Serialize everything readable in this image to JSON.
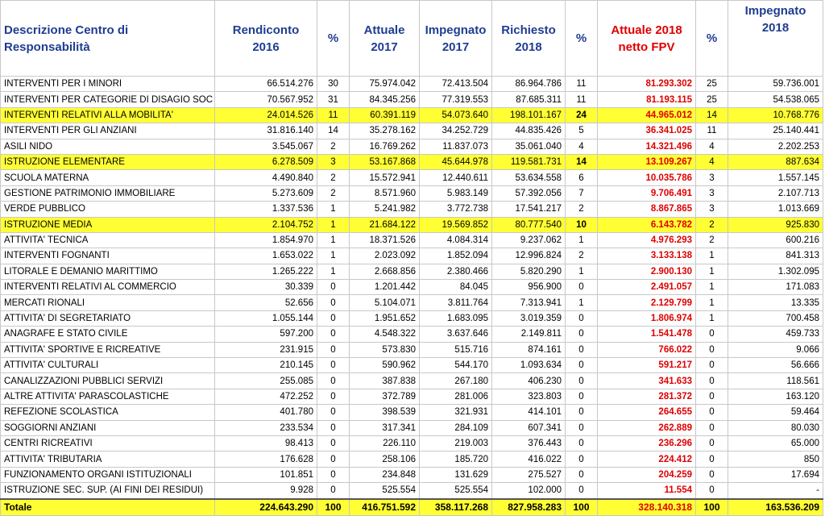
{
  "headers": {
    "desc": "Descrizione  Centro di Responsabilità",
    "rendiconto": "Rendiconto 2016",
    "pct1": "%",
    "attuale": "Attuale 2017",
    "impegnato": "Impegnato 2017",
    "richiesto": "Richiesto 2018",
    "pct2": "%",
    "attuale_fpv": "Attuale 2018 netto FPV",
    "pct3": "%",
    "impegnato_2018": "Impegnato 2018"
  },
  "rows": [
    {
      "name": "INTERVENTI PER I MINORI",
      "r2016": "66.514.276",
      "p1": "30",
      "a2017": "75.974.042",
      "i2017": "72.413.504",
      "r2018": "86.964.786",
      "p2": "11",
      "fpv": "81.293.302",
      "p3": "25",
      "i2018": "59.736.001",
      "hl": false
    },
    {
      "name": "INTERVENTI PER CATEGORIE DI DISAGIO SOC",
      "r2016": "70.567.952",
      "p1": "31",
      "a2017": "84.345.256",
      "i2017": "77.319.553",
      "r2018": "87.685.311",
      "p2": "11",
      "fpv": "81.193.115",
      "p3": "25",
      "i2018": "54.538.065",
      "hl": false
    },
    {
      "name": "INTERVENTI RELATIVI ALLA MOBILITA'",
      "r2016": "24.014.526",
      "p1": "11",
      "a2017": "60.391.119",
      "i2017": "54.073.640",
      "r2018": "198.101.167",
      "p2": "24",
      "fpv": "44.965.012",
      "p3": "14",
      "i2018": "10.768.776",
      "hl": true
    },
    {
      "name": "INTERVENTI PER GLI ANZIANI",
      "r2016": "31.816.140",
      "p1": "14",
      "a2017": "35.278.162",
      "i2017": "34.252.729",
      "r2018": "44.835.426",
      "p2": "5",
      "fpv": "36.341.025",
      "p3": "11",
      "i2018": "25.140.441",
      "hl": false
    },
    {
      "name": "ASILI NIDO",
      "r2016": "3.545.067",
      "p1": "2",
      "a2017": "16.769.262",
      "i2017": "11.837.073",
      "r2018": "35.061.040",
      "p2": "4",
      "fpv": "14.321.496",
      "p3": "4",
      "i2018": "2.202.253",
      "hl": false
    },
    {
      "name": "ISTRUZIONE ELEMENTARE",
      "r2016": "6.278.509",
      "p1": "3",
      "a2017": "53.167.868",
      "i2017": "45.644.978",
      "r2018": "119.581.731",
      "p2": "14",
      "fpv": "13.109.267",
      "p3": "4",
      "i2018": "887.634",
      "hl": true
    },
    {
      "name": "SCUOLA MATERNA",
      "r2016": "4.490.840",
      "p1": "2",
      "a2017": "15.572.941",
      "i2017": "12.440.611",
      "r2018": "53.634.558",
      "p2": "6",
      "fpv": "10.035.786",
      "p3": "3",
      "i2018": "1.557.145",
      "hl": false
    },
    {
      "name": "GESTIONE PATRIMONIO IMMOBILIARE",
      "r2016": "5.273.609",
      "p1": "2",
      "a2017": "8.571.960",
      "i2017": "5.983.149",
      "r2018": "57.392.056",
      "p2": "7",
      "fpv": "9.706.491",
      "p3": "3",
      "i2018": "2.107.713",
      "hl": false
    },
    {
      "name": "VERDE PUBBLICO",
      "r2016": "1.337.536",
      "p1": "1",
      "a2017": "5.241.982",
      "i2017": "3.772.738",
      "r2018": "17.541.217",
      "p2": "2",
      "fpv": "8.867.865",
      "p3": "3",
      "i2018": "1.013.669",
      "hl": false
    },
    {
      "name": "ISTRUZIONE MEDIA",
      "r2016": "2.104.752",
      "p1": "1",
      "a2017": "21.684.122",
      "i2017": "19.569.852",
      "r2018": "80.777.540",
      "p2": "10",
      "fpv": "6.143.782",
      "p3": "2",
      "i2018": "925.830",
      "hl": true
    },
    {
      "name": "ATTIVITA' TECNICA",
      "r2016": "1.854.970",
      "p1": "1",
      "a2017": "18.371.526",
      "i2017": "4.084.314",
      "r2018": "9.237.062",
      "p2": "1",
      "fpv": "4.976.293",
      "p3": "2",
      "i2018": "600.216",
      "hl": false
    },
    {
      "name": "INTERVENTI FOGNANTI",
      "r2016": "1.653.022",
      "p1": "1",
      "a2017": "2.023.092",
      "i2017": "1.852.094",
      "r2018": "12.996.824",
      "p2": "2",
      "fpv": "3.133.138",
      "p3": "1",
      "i2018": "841.313",
      "hl": false
    },
    {
      "name": "LITORALE E DEMANIO MARITTIMO",
      "r2016": "1.265.222",
      "p1": "1",
      "a2017": "2.668.856",
      "i2017": "2.380.466",
      "r2018": "5.820.290",
      "p2": "1",
      "fpv": "2.900.130",
      "p3": "1",
      "i2018": "1.302.095",
      "hl": false
    },
    {
      "name": "INTERVENTI RELATIVI AL COMMERCIO",
      "r2016": "30.339",
      "p1": "0",
      "a2017": "1.201.442",
      "i2017": "84.045",
      "r2018": "956.900",
      "p2": "0",
      "fpv": "2.491.057",
      "p3": "1",
      "i2018": "171.083",
      "hl": false
    },
    {
      "name": "MERCATI RIONALI",
      "r2016": "52.656",
      "p1": "0",
      "a2017": "5.104.071",
      "i2017": "3.811.764",
      "r2018": "7.313.941",
      "p2": "1",
      "fpv": "2.129.799",
      "p3": "1",
      "i2018": "13.335",
      "hl": false
    },
    {
      "name": "ATTIVITA' DI SEGRETARIATO",
      "r2016": "1.055.144",
      "p1": "0",
      "a2017": "1.951.652",
      "i2017": "1.683.095",
      "r2018": "3.019.359",
      "p2": "0",
      "fpv": "1.806.974",
      "p3": "1",
      "i2018": "700.458",
      "hl": false
    },
    {
      "name": "ANAGRAFE E STATO CIVILE",
      "r2016": "597.200",
      "p1": "0",
      "a2017": "4.548.322",
      "i2017": "3.637.646",
      "r2018": "2.149.811",
      "p2": "0",
      "fpv": "1.541.478",
      "p3": "0",
      "i2018": "459.733",
      "hl": false
    },
    {
      "name": "ATTIVITA' SPORTIVE E RICREATIVE",
      "r2016": "231.915",
      "p1": "0",
      "a2017": "573.830",
      "i2017": "515.716",
      "r2018": "874.161",
      "p2": "0",
      "fpv": "766.022",
      "p3": "0",
      "i2018": "9.066",
      "hl": false
    },
    {
      "name": "ATTIVITA' CULTURALI",
      "r2016": "210.145",
      "p1": "0",
      "a2017": "590.962",
      "i2017": "544.170",
      "r2018": "1.093.634",
      "p2": "0",
      "fpv": "591.217",
      "p3": "0",
      "i2018": "56.666",
      "hl": false
    },
    {
      "name": "CANALIZZAZIONI PUBBLICI SERVIZI",
      "r2016": "255.085",
      "p1": "0",
      "a2017": "387.838",
      "i2017": "267.180",
      "r2018": "406.230",
      "p2": "0",
      "fpv": "341.633",
      "p3": "0",
      "i2018": "118.561",
      "hl": false
    },
    {
      "name": "ALTRE ATTIVITA' PARASCOLASTICHE",
      "r2016": "472.252",
      "p1": "0",
      "a2017": "372.789",
      "i2017": "281.006",
      "r2018": "323.803",
      "p2": "0",
      "fpv": "281.372",
      "p3": "0",
      "i2018": "163.120",
      "hl": false
    },
    {
      "name": "REFEZIONE SCOLASTICA",
      "r2016": "401.780",
      "p1": "0",
      "a2017": "398.539",
      "i2017": "321.931",
      "r2018": "414.101",
      "p2": "0",
      "fpv": "264.655",
      "p3": "0",
      "i2018": "59.464",
      "hl": false
    },
    {
      "name": "SOGGIORNI ANZIANI",
      "r2016": "233.534",
      "p1": "0",
      "a2017": "317.341",
      "i2017": "284.109",
      "r2018": "607.341",
      "p2": "0",
      "fpv": "262.889",
      "p3": "0",
      "i2018": "80.030",
      "hl": false
    },
    {
      "name": "CENTRI RICREATIVI",
      "r2016": "98.413",
      "p1": "0",
      "a2017": "226.110",
      "i2017": "219.003",
      "r2018": "376.443",
      "p2": "0",
      "fpv": "236.296",
      "p3": "0",
      "i2018": "65.000",
      "hl": false
    },
    {
      "name": "ATTIVITA' TRIBUTARIA",
      "r2016": "176.628",
      "p1": "0",
      "a2017": "258.106",
      "i2017": "185.720",
      "r2018": "416.022",
      "p2": "0",
      "fpv": "224.412",
      "p3": "0",
      "i2018": "850",
      "hl": false
    },
    {
      "name": "FUNZIONAMENTO ORGANI ISTITUZIONALI",
      "r2016": "101.851",
      "p1": "0",
      "a2017": "234.848",
      "i2017": "131.629",
      "r2018": "275.527",
      "p2": "0",
      "fpv": "204.259",
      "p3": "0",
      "i2018": "17.694",
      "hl": false
    },
    {
      "name": "ISTRUZIONE SEC. SUP.  (AI FINI DEI RESIDUI)",
      "r2016": "9.928",
      "p1": "0",
      "a2017": "525.554",
      "i2017": "525.554",
      "r2018": "102.000",
      "p2": "0",
      "fpv": "11.554",
      "p3": "0",
      "i2018": "-",
      "hl": false
    }
  ],
  "total": {
    "name": "Totale",
    "r2016": "224.643.290",
    "p1": "100",
    "a2017": "416.751.592",
    "i2017": "358.117.268",
    "r2018": "827.958.283",
    "p2": "100",
    "fpv": "328.140.318",
    "p3": "100",
    "i2018": "163.536.209"
  },
  "colors": {
    "header_text": "#1f3d91",
    "accent_red": "#e00000",
    "highlight": "#ffff33"
  }
}
